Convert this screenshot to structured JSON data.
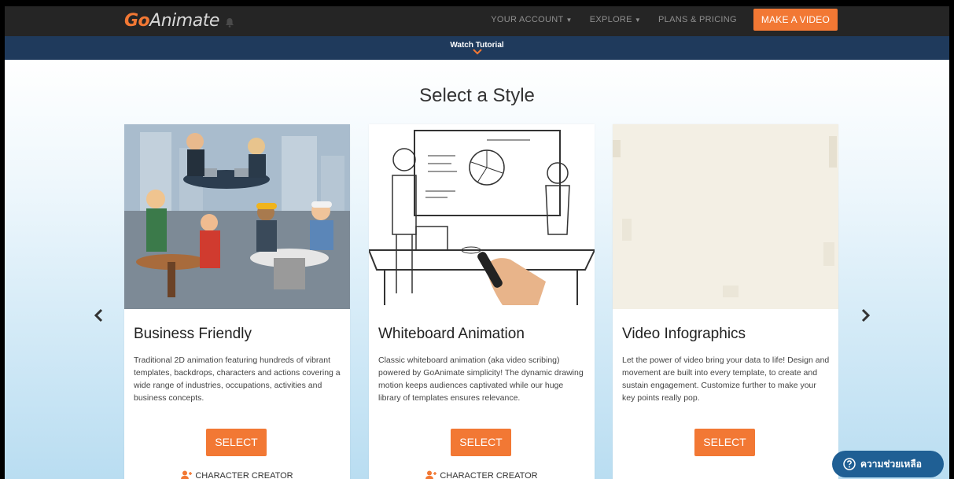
{
  "nav": {
    "logo_go": "Go",
    "logo_rest": "Animate",
    "your_account": "YOUR ACCOUNT",
    "explore": "EXPLORE",
    "plans": "PLANS & PRICING",
    "make_video": "MAKE A VIDEO"
  },
  "subbar": {
    "label": "Watch Tutorial"
  },
  "page": {
    "title": "Select a Style"
  },
  "cards": [
    {
      "title": "Business Friendly",
      "description": "Traditional 2D animation featuring hundreds of vibrant templates, backdrops, characters and actions covering a wide range of industries, occupations, activities and business concepts.",
      "select": "SELECT",
      "creator": "CHARACTER CREATOR"
    },
    {
      "title": "Whiteboard Animation",
      "description": "Classic whiteboard animation (aka video scribing) powered by GoAnimate simplicity! The dynamic drawing motion keeps audiences captivated while our huge library of templates ensures relevance.",
      "select": "SELECT",
      "creator": "CHARACTER CREATOR"
    },
    {
      "title": "Video Infographics",
      "description": "Let the power of video bring your data to life! Design and movement are built into every template, to create and sustain engagement. Customize further to make your key points really pop.",
      "select": "SELECT"
    }
  ],
  "help": {
    "label": "ความช่วยเหลือ"
  },
  "colors": {
    "accent": "#f27834",
    "nav_bg": "#252525",
    "subbar_bg": "#1f3a5c",
    "help_bg": "#1f5f94"
  }
}
